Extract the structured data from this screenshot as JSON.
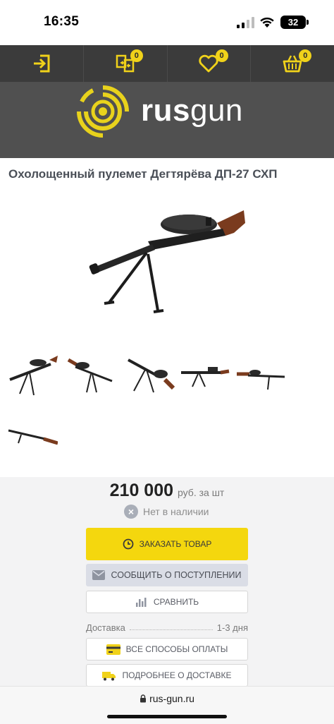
{
  "status": {
    "time": "16:35",
    "battery": "32"
  },
  "toolbar": {
    "items": [
      {
        "name": "login",
        "icon": "login-icon",
        "badge": ""
      },
      {
        "name": "compare",
        "icon": "compare-icon",
        "badge": "0"
      },
      {
        "name": "favorites",
        "icon": "heart-icon",
        "badge": "0"
      },
      {
        "name": "cart",
        "icon": "basket-icon",
        "badge": "0"
      }
    ],
    "accent": "#f0d21a",
    "background": "#3b3b3b"
  },
  "logo": {
    "text_bold": "rus",
    "text_light": "gun",
    "mark_color": "#e8d21c"
  },
  "product": {
    "title": "Охолощенный пулемет Дегтярёва ДП-27 СХП",
    "thumbnail_count": 6
  },
  "purchase": {
    "price": "210 000",
    "price_unit": "руб. за шт",
    "availability": "Нет в наличии",
    "order_label": "ЗАКАЗАТЬ ТОВАР",
    "notify_label": "СООБЩИТЬ О ПОСТУПЛЕНИИ",
    "compare_label": "СРАВНИТЬ",
    "delivery_label": "Доставка",
    "delivery_value": "1-3 дня",
    "payment_label": "ВСЕ СПОСОБЫ ОПЛАТЫ",
    "delivery_more_label": "ПОДРОБНЕЕ О ДОСТАВКЕ",
    "order_color": "#f4d70e"
  },
  "browser": {
    "url": "rus-gun.ru"
  }
}
